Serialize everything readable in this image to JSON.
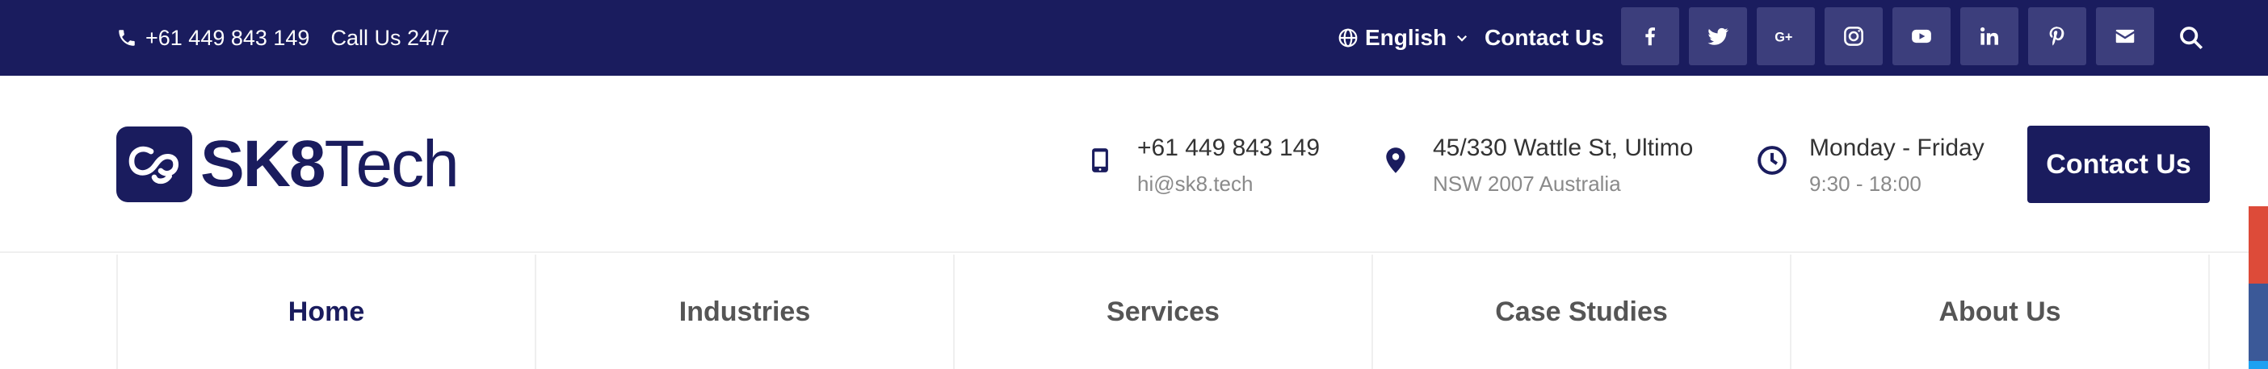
{
  "topbar": {
    "phone": "+61 449 843 149",
    "call_label": "Call Us 24/7",
    "language": "English",
    "contact_link": "Contact Us",
    "social": [
      "facebook-icon",
      "twitter-icon",
      "google-plus-icon",
      "instagram-icon",
      "youtube-icon",
      "linkedin-icon",
      "pinterest-icon",
      "mail-icon"
    ],
    "search_icon": "search-icon"
  },
  "header": {
    "logo_bold": "SK8",
    "logo_light": "Tech",
    "phone": {
      "line1": "+61 449 843 149",
      "line2": "hi@sk8.tech"
    },
    "address": {
      "line1": "45/330 Wattle St, Ultimo",
      "line2": "NSW 2007 Australia"
    },
    "hours": {
      "line1": "Monday - Friday",
      "line2": "9:30 - 18:00"
    },
    "cta": "Contact Us"
  },
  "nav": {
    "items": [
      {
        "label": "Home",
        "active": true
      },
      {
        "label": "Industries",
        "active": false
      },
      {
        "label": "Services",
        "active": false
      },
      {
        "label": "Case Studies",
        "active": false
      },
      {
        "label": "About Us",
        "active": false
      }
    ]
  },
  "colors": {
    "brand": "#1a1c5e",
    "social_bg": "#3c3e7c",
    "strip_red": "#dd4b39",
    "strip_blue": "#3b5998",
    "strip_light": "#1da1f2"
  }
}
